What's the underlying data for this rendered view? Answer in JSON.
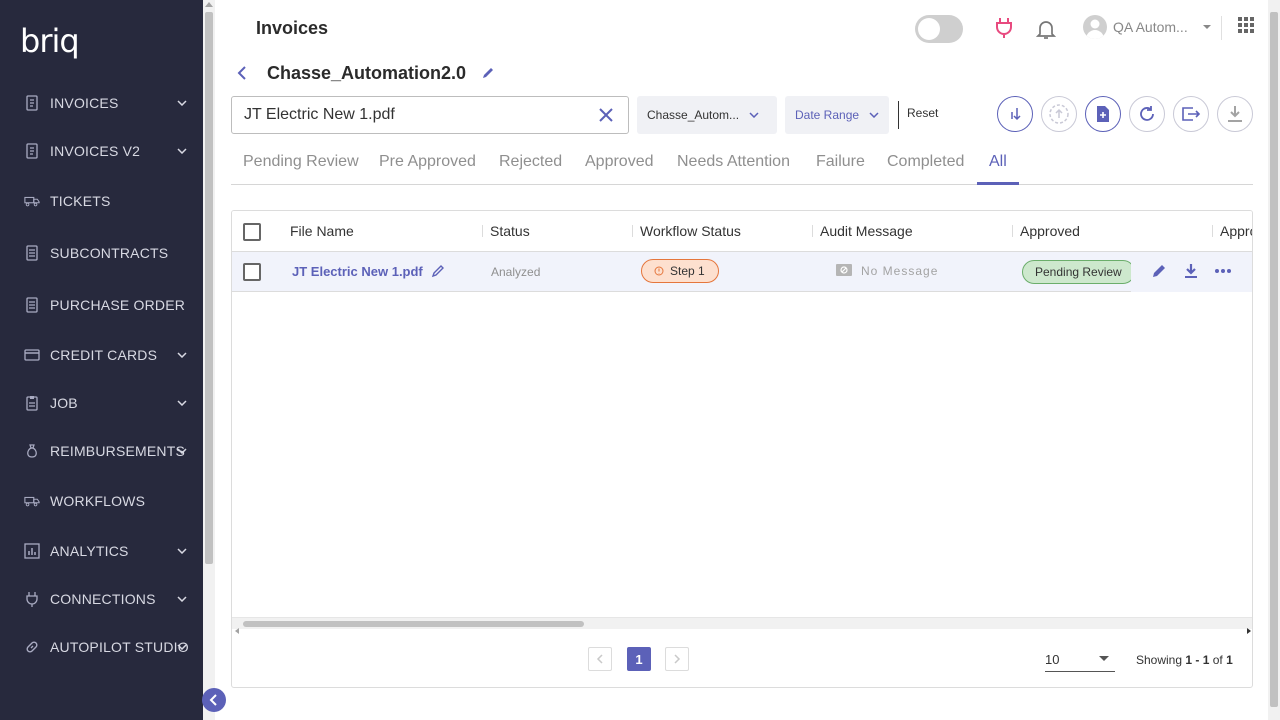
{
  "app": {
    "logo": "briq"
  },
  "sidebar": {
    "items": [
      {
        "label": "INVOICES",
        "icon": "invoice-icon",
        "has_chevron": true
      },
      {
        "label": "INVOICES V2",
        "icon": "invoice-icon",
        "has_chevron": true
      },
      {
        "label": "TICKETS",
        "icon": "truck-icon",
        "has_chevron": false
      },
      {
        "label": "SUBCONTRACTS",
        "icon": "document-icon",
        "has_chevron": false
      },
      {
        "label": "PURCHASE ORDER",
        "icon": "document-icon",
        "has_chevron": false
      },
      {
        "label": "CREDIT CARDS",
        "icon": "credit-card-icon",
        "has_chevron": true
      },
      {
        "label": "JOB",
        "icon": "clipboard-icon",
        "has_chevron": true
      },
      {
        "label": "REIMBURSEMENTS",
        "icon": "money-bag-icon",
        "has_chevron": true
      },
      {
        "label": "WORKFLOWS",
        "icon": "workflow-icon",
        "has_chevron": false
      },
      {
        "label": "ANALYTICS",
        "icon": "analytics-icon",
        "has_chevron": true
      },
      {
        "label": "CONNECTIONS",
        "icon": "plug-icon",
        "has_chevron": true
      },
      {
        "label": "AUTOPILOT STUDIO",
        "icon": "link-icon",
        "has_chevron": true
      }
    ]
  },
  "header": {
    "title": "Invoices",
    "user_name": "QA Autom..."
  },
  "document": {
    "title": "Chasse_Automation2.0"
  },
  "filters": {
    "search_value": "JT Electric New 1.pdf",
    "company_filter": "Chasse_Autom...",
    "date_range": "Date Range",
    "reset": "Reset"
  },
  "tabs": [
    {
      "label": "Pending Review",
      "active": false
    },
    {
      "label": "Pre Approved",
      "active": false
    },
    {
      "label": "Rejected",
      "active": false
    },
    {
      "label": "Approved",
      "active": false
    },
    {
      "label": "Needs Attention",
      "active": false
    },
    {
      "label": "Failure",
      "active": false
    },
    {
      "label": "Completed",
      "active": false
    },
    {
      "label": "All",
      "active": true
    }
  ],
  "table": {
    "columns": [
      "File Name",
      "Status",
      "Workflow Status",
      "Audit Message",
      "Approved",
      "Appro"
    ],
    "rows": [
      {
        "file_name": "JT Electric New 1.pdf",
        "status": "Analyzed",
        "workflow_status": "Step 1",
        "audit_message": "No Message",
        "approved": "Pending Review"
      }
    ]
  },
  "pagination": {
    "current_page": "1",
    "per_page": "10",
    "showing_prefix": "Showing ",
    "showing_range": "1 - 1",
    "showing_mid": " of ",
    "showing_total": "1"
  },
  "colors": {
    "sidebar_bg": "#27293d",
    "accent": "#5c61b8",
    "row_highlight": "#f1f3fb",
    "warning_badge": "#fde0cf",
    "success_badge": "#cde8cd"
  }
}
